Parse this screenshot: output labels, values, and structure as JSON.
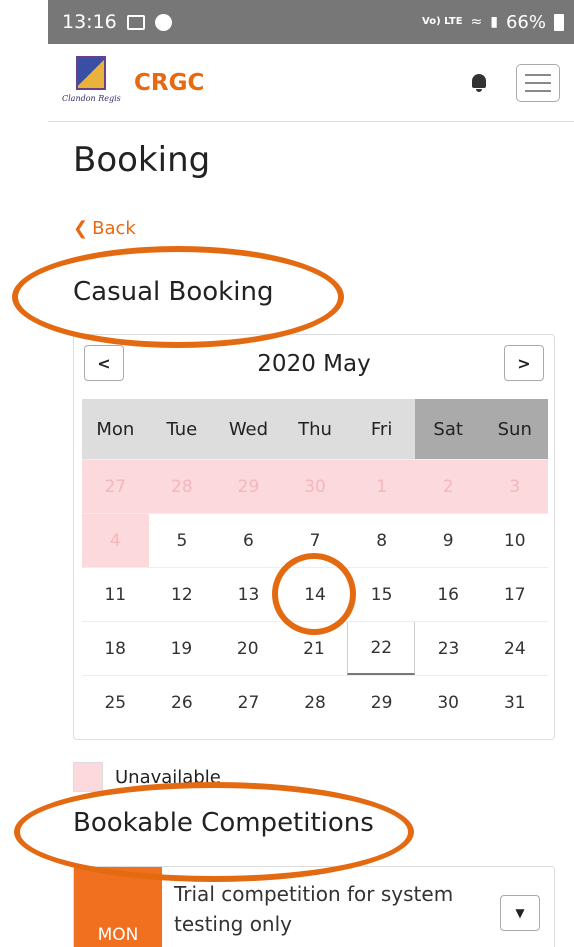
{
  "status_bar": {
    "time": "13:16",
    "lte": "Vo) LTE",
    "battery": "66%"
  },
  "header": {
    "logo_text": "Clandon Regis",
    "brand": "CRGC"
  },
  "page": {
    "title": "Booking",
    "back": "Back"
  },
  "casual": {
    "title": "Casual Booking"
  },
  "calendar": {
    "prev": "<",
    "next": ">",
    "title": "2020 May",
    "days_of_week": [
      "Mon",
      "Tue",
      "Wed",
      "Thu",
      "Fri",
      "Sat",
      "Sun"
    ],
    "weeks": [
      [
        {
          "d": "27",
          "unavailable": true
        },
        {
          "d": "28",
          "unavailable": true
        },
        {
          "d": "29",
          "unavailable": true
        },
        {
          "d": "30",
          "unavailable": true
        },
        {
          "d": "1",
          "unavailable": true
        },
        {
          "d": "2",
          "unavailable": true
        },
        {
          "d": "3",
          "unavailable": true
        }
      ],
      [
        {
          "d": "4",
          "unavailable": true
        },
        {
          "d": "5"
        },
        {
          "d": "6"
        },
        {
          "d": "7"
        },
        {
          "d": "8"
        },
        {
          "d": "9"
        },
        {
          "d": "10"
        }
      ],
      [
        {
          "d": "11"
        },
        {
          "d": "12"
        },
        {
          "d": "13"
        },
        {
          "d": "14"
        },
        {
          "d": "15"
        },
        {
          "d": "16"
        },
        {
          "d": "17"
        }
      ],
      [
        {
          "d": "18"
        },
        {
          "d": "19"
        },
        {
          "d": "20"
        },
        {
          "d": "21"
        },
        {
          "d": "22",
          "today": true
        },
        {
          "d": "23"
        },
        {
          "d": "24"
        }
      ],
      [
        {
          "d": "25"
        },
        {
          "d": "26"
        },
        {
          "d": "27"
        },
        {
          "d": "28"
        },
        {
          "d": "29"
        },
        {
          "d": "30"
        },
        {
          "d": "31"
        }
      ]
    ]
  },
  "legend": {
    "label": "Unavailable"
  },
  "bookable": {
    "title": "Bookable Competitions",
    "item": {
      "day": "MON",
      "title": "Trial competition for system testing only"
    }
  },
  "colors": {
    "accent": "#e86a10",
    "unavailable": "#fbd9dc",
    "annotation": "#e46a12"
  }
}
